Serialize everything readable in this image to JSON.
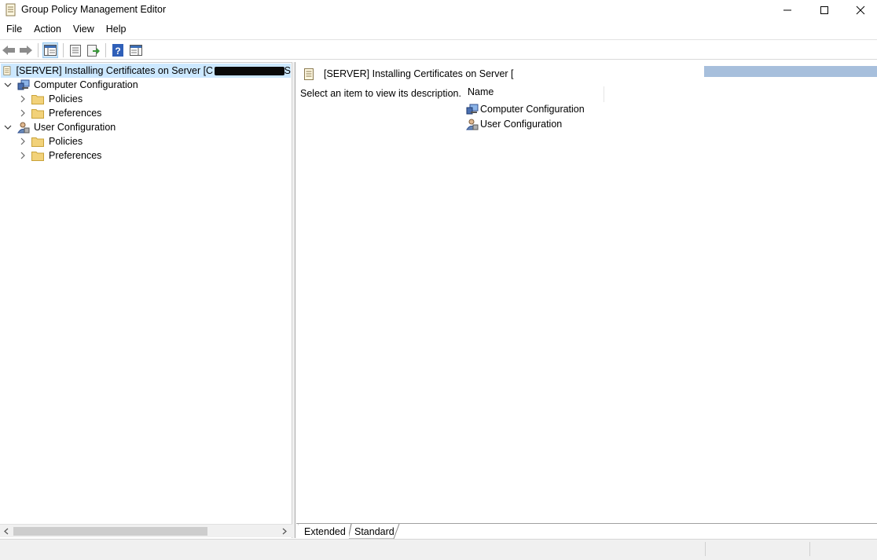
{
  "window": {
    "title": "Group Policy Management Editor"
  },
  "menu": [
    "File",
    "Action",
    "View",
    "Help"
  ],
  "tree": {
    "root_label": "[SERVER] Installing Certificates on Server [C",
    "root_trailing": "S",
    "computer_config": "Computer Configuration",
    "user_config": "User Configuration",
    "policies": "Policies",
    "preferences": "Preferences"
  },
  "details": {
    "header_title": "[SERVER] Installing Certificates on Server [",
    "description": "Select an item to view its description.",
    "column_name": "Name",
    "items": [
      "Computer Configuration",
      "User Configuration"
    ]
  },
  "tabs": {
    "extended": "Extended",
    "standard": "Standard"
  },
  "colors": {
    "selection": "#cce8ff",
    "header_band": "#a7bfdc",
    "folder": "#e8c15c"
  }
}
